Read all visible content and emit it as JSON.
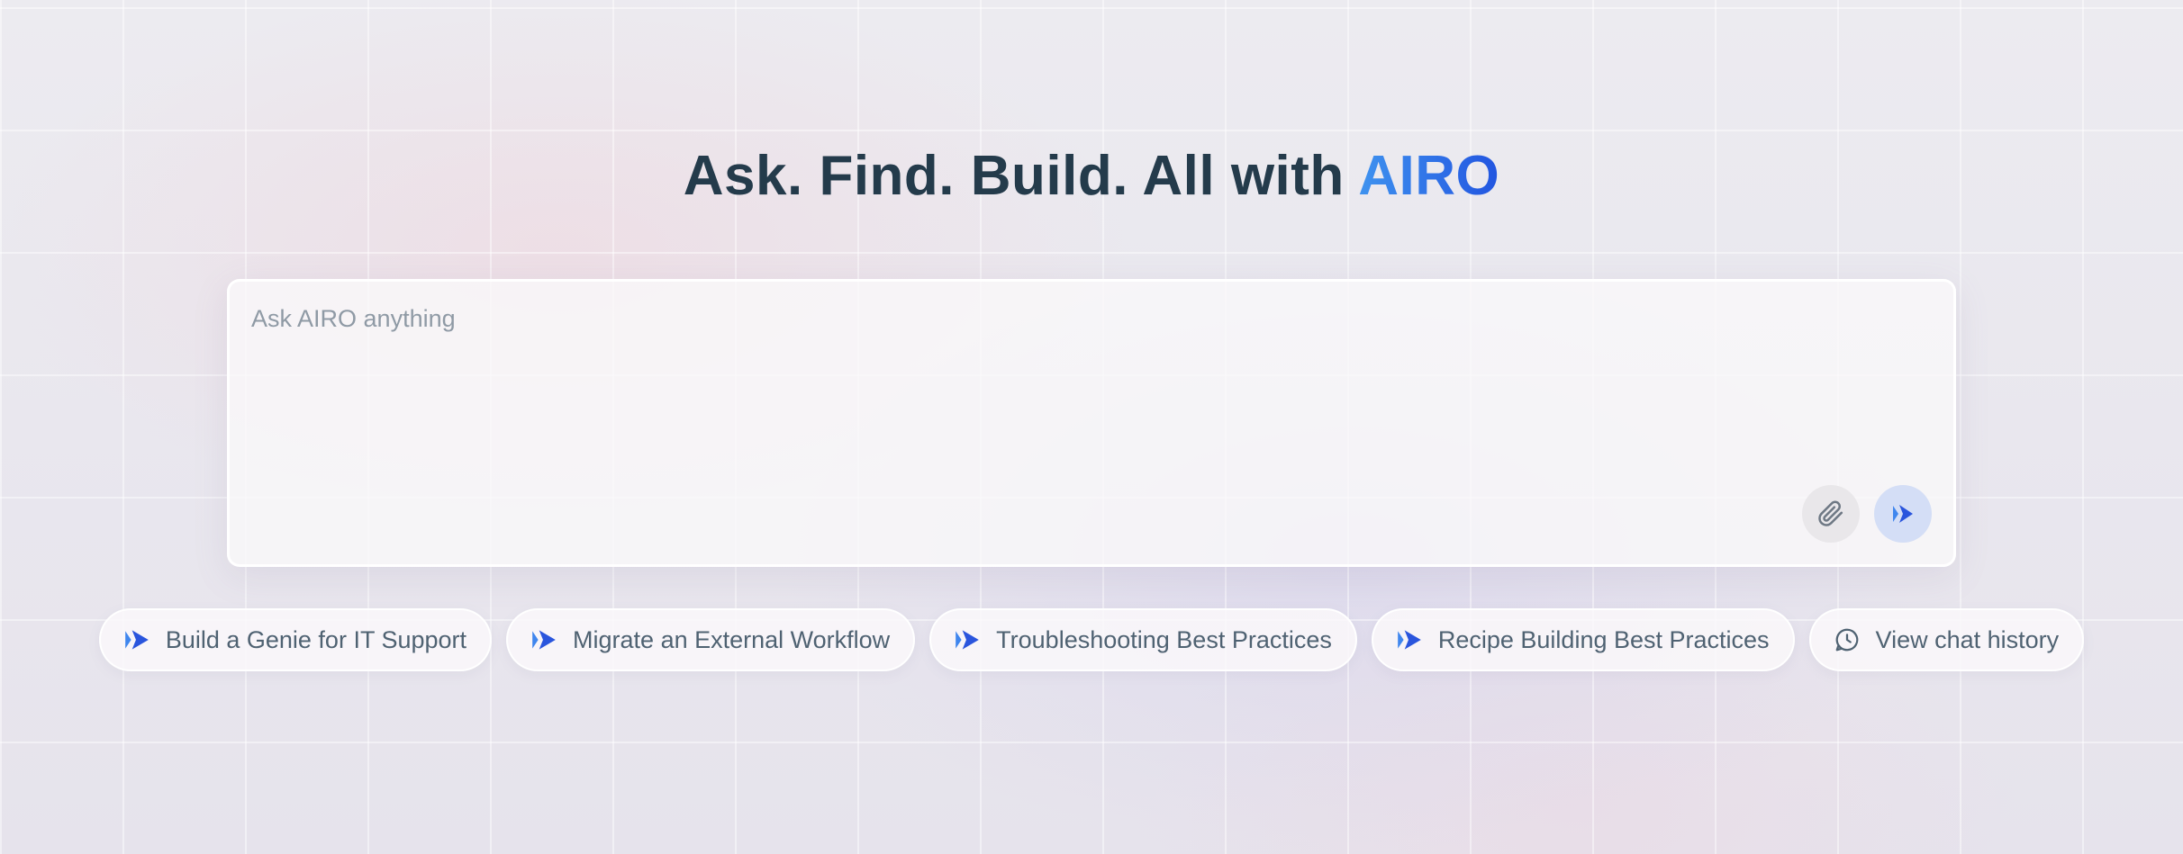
{
  "hero": {
    "title_prefix": "Ask. Find. Build. All with ",
    "brand": "AIRO"
  },
  "prompt": {
    "placeholder": "Ask AIRO anything",
    "value": "",
    "attach_icon": "paperclip-icon",
    "send_icon": "double-play-icon"
  },
  "chips": [
    {
      "label": "Build a Genie for IT Support",
      "icon": "double-play-icon"
    },
    {
      "label": "Migrate an External Workflow",
      "icon": "double-play-icon"
    },
    {
      "label": "Troubleshooting Best Practices",
      "icon": "double-play-icon"
    },
    {
      "label": "Recipe Building Best Practices",
      "icon": "double-play-icon"
    },
    {
      "label": "View chat history",
      "icon": "clock-chat-icon"
    }
  ],
  "colors": {
    "accent": "#2f5fe3",
    "accent_light": "#3f93ef",
    "title": "#243b4b",
    "chip_text": "#4f6272",
    "placeholder": "#8f9aa5"
  }
}
